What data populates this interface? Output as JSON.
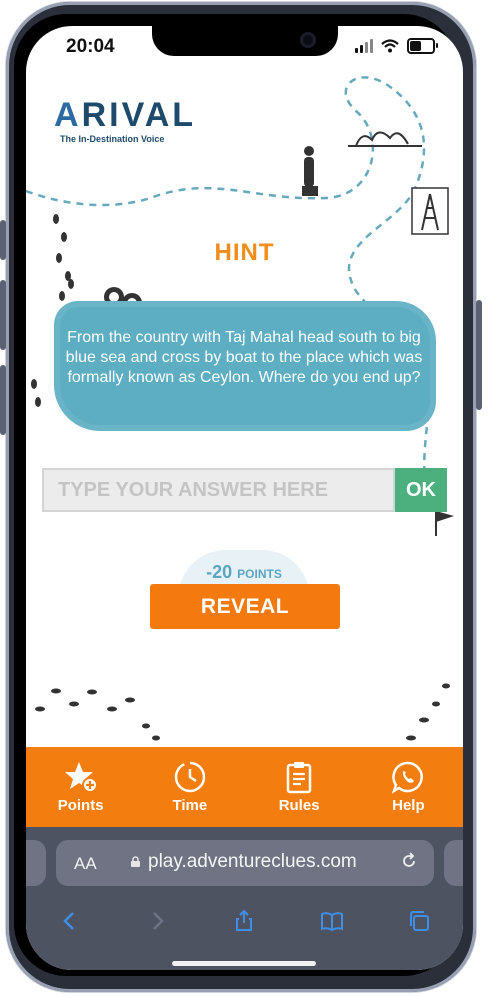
{
  "status_bar": {
    "time": "20:04"
  },
  "brand": {
    "logo_first": "A",
    "logo_rest": "RIVAL",
    "tagline": "The In-Destination Voice"
  },
  "hint": {
    "title": "HINT",
    "text": "From the country with Taj Mahal head south to big blue sea and cross by boat to the place which was formally known as Ceylon. Where do you end up?"
  },
  "answer": {
    "placeholder": "TYPE YOUR ANSWER HERE",
    "value": "",
    "ok_label": "OK"
  },
  "reveal": {
    "penalty_value": "-20",
    "penalty_unit": "POINTS",
    "label": "REVEAL"
  },
  "nav": {
    "items": [
      {
        "label": "Points",
        "icon": "star-plus-icon"
      },
      {
        "label": "Time",
        "icon": "clock-icon"
      },
      {
        "label": "Rules",
        "icon": "clipboard-icon"
      },
      {
        "label": "Help",
        "icon": "whatsapp-icon"
      }
    ]
  },
  "browser": {
    "text_size_label": "AA",
    "url": "play.adventureclues.com"
  },
  "colors": {
    "accent_orange": "#f47d0f",
    "hint_blue": "#5eaec3",
    "ok_green": "#4caf7e",
    "title_orange": "#f28c1b",
    "brand_navy": "#1e4b6b"
  }
}
